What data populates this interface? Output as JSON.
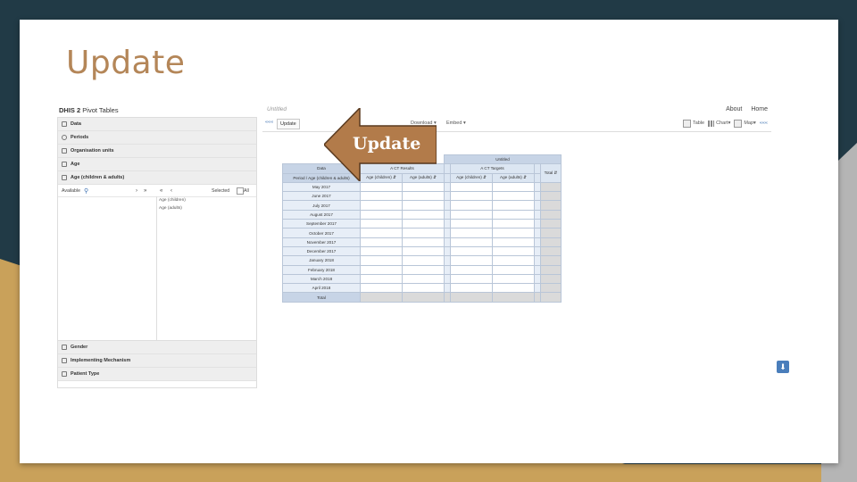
{
  "slide": {
    "title": "Update"
  },
  "app": {
    "brand_bold": "DHIS 2",
    "brand_rest": " Pivot Tables",
    "favorite_name": "Untitled",
    "top_links": [
      "About",
      "Home"
    ],
    "toolbar": {
      "collapse_left": "«««",
      "update_label": "Update",
      "download_label": "Download",
      "embed_label": "Embed",
      "table_label": "Table",
      "chart_label": "Chart",
      "map_label": "Map",
      "collapse_right": "«««"
    },
    "dimensions": [
      "Data",
      "Periods",
      "Organisation units",
      "Age",
      "Age (children & adults)"
    ],
    "selector": {
      "available_label": "Available",
      "selected_label": "Selected",
      "all_label": "All",
      "selected_items": [
        "Age (children)",
        "Age (adults)"
      ]
    },
    "lower_dimensions": [
      "Gender",
      "Implementing Mechanism",
      "Patient Type"
    ]
  },
  "pivot": {
    "title": "Untitled",
    "corner_top": "Data",
    "corner_bottom": "Period / Age (children & adults)",
    "groups": [
      "A CT Results",
      "A CT Targets"
    ],
    "subheaders": [
      "Age (children)",
      "Age (adults)",
      "Age (children)",
      "Age (adults)"
    ],
    "total_label": "Total",
    "rows": [
      "May 2017",
      "June 2017",
      "July 2017",
      "August 2017",
      "September 2017",
      "October 2017",
      "November 2017",
      "December 2017",
      "January 2018",
      "February 2018",
      "March 2018",
      "April 2018"
    ]
  },
  "callout": {
    "label": "Update",
    "color": "#b27b4a"
  },
  "colors": {
    "background": "#213a46",
    "accent_gold": "#c9a15a",
    "title": "#b48658",
    "pivot_header": "#dce6f2"
  }
}
